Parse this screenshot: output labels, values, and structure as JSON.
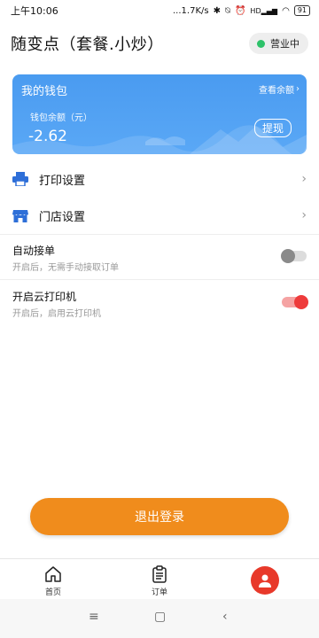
{
  "status_bar": {
    "time": "上午10:06",
    "network_speed": "...1.7K/s",
    "signal_label": "HD",
    "battery": "91"
  },
  "header": {
    "title": "随变点（套餐.小炒）",
    "status_label": "营业中",
    "status_color": "#2ec26a"
  },
  "wallet": {
    "title": "我的钱包",
    "view_balance_link": "查看余额",
    "balance_label": "钱包余额（元）",
    "balance_value": "-2.62",
    "withdraw_label": "提现",
    "color": "#4a9bf0"
  },
  "menu": {
    "print_settings": "打印设置",
    "store_settings": "门店设置"
  },
  "toggles": {
    "auto_accept": {
      "title": "自动接单",
      "subtitle": "开启后，无需手动接取订单",
      "enabled": false
    },
    "cloud_printer": {
      "title": "开启云打印机",
      "subtitle": "开启后，启用云打印机",
      "enabled": true
    }
  },
  "logout_label": "退出登录",
  "accent_color": "#f08c1c",
  "tabbar": {
    "home_label": "首页",
    "orders_label": "订单"
  }
}
